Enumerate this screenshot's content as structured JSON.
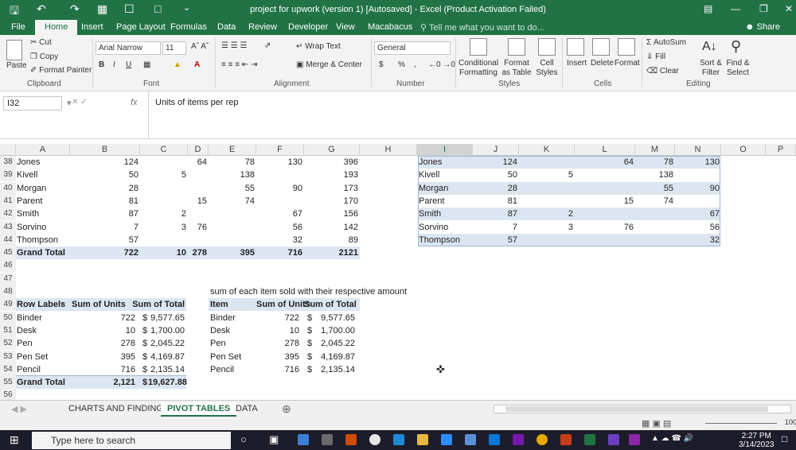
{
  "window": {
    "title": "project for upwork (version 1) [Autosaved] - Excel (Product Activation Failed)"
  },
  "tabs": [
    "File",
    "Home",
    "Insert",
    "Page Layout",
    "Formulas",
    "Data",
    "Review",
    "Developer",
    "View",
    "Macabacus"
  ],
  "active_tab": "Home",
  "tell_me": "Tell me what you want to do...",
  "share": "Share",
  "ribbon": {
    "clipboard": {
      "group": "Clipboard",
      "paste": "Paste",
      "cut": "Cut",
      "copy": "Copy",
      "format_painter": "Format Painter"
    },
    "font": {
      "group": "Font",
      "name": "Arial Narrow",
      "size": "11",
      "bold": "B",
      "italic": "I",
      "underline": "U"
    },
    "alignment": {
      "group": "Alignment",
      "wrap": "Wrap Text",
      "merge": "Merge & Center"
    },
    "number": {
      "group": "Number",
      "format": "General",
      "currency": "$",
      "percent": "%",
      "comma": ","
    },
    "styles": {
      "group": "Styles",
      "conditional": "Conditional Formatting",
      "format_table": "Format as Table",
      "cell_styles": "Cell Styles"
    },
    "cells": {
      "group": "Cells",
      "insert": "Insert",
      "delete": "Delete",
      "format": "Format"
    },
    "editing": {
      "group": "Editing",
      "autosum": "AutoSum",
      "fill": "Fill",
      "clear": "Clear",
      "sort": "Sort & Filter",
      "find": "Find & Select"
    }
  },
  "formula_bar": {
    "name_box": "I32",
    "fx": "fx",
    "formula": "Units of items per rep"
  },
  "columns": [
    "A",
    "B",
    "C",
    "D",
    "E",
    "F",
    "G",
    "H",
    "I",
    "J",
    "K",
    "L",
    "M",
    "N",
    "O",
    "P"
  ],
  "selected_column": "I",
  "rows": [
    "38",
    "39",
    "40",
    "41",
    "42",
    "43",
    "44",
    "45",
    "46",
    "47",
    "48",
    "49",
    "50",
    "51",
    "52",
    "53",
    "54",
    "55",
    "56"
  ],
  "left_table": [
    [
      "Jones",
      "124",
      "",
      "64",
      "78",
      "130",
      "396"
    ],
    [
      "Kivell",
      "50",
      "5",
      "",
      "138",
      "",
      "193"
    ],
    [
      "Morgan",
      "28",
      "",
      "",
      "55",
      "90",
      "173"
    ],
    [
      "Parent",
      "81",
      "",
      "15",
      "74",
      "",
      "170"
    ],
    [
      "Smith",
      "87",
      "2",
      "",
      "",
      "67",
      "156"
    ],
    [
      "Sorvino",
      "7",
      "3",
      "76",
      "",
      "56",
      "142"
    ],
    [
      "Thompson",
      "57",
      "",
      "",
      "",
      "32",
      "89"
    ],
    [
      "Grand Total",
      "722",
      "10",
      "278",
      "395",
      "716",
      "2121"
    ]
  ],
  "right_table": [
    [
      "Jones",
      "124",
      "",
      "64",
      "78",
      "130"
    ],
    [
      "Kivell",
      "50",
      "5",
      "",
      "138",
      ""
    ],
    [
      "Morgan",
      "28",
      "",
      "",
      "55",
      "90"
    ],
    [
      "Parent",
      "81",
      "",
      "15",
      "74",
      ""
    ],
    [
      "Smith",
      "87",
      "2",
      "",
      "",
      "67"
    ],
    [
      "Sorvino",
      "7",
      "3",
      "76",
      "",
      "56"
    ],
    [
      "Thompson",
      "57",
      "",
      "",
      "",
      "32"
    ]
  ],
  "pivot": {
    "headers": [
      "Row Labels",
      "Sum of Units",
      "Sum of Total"
    ],
    "rows": [
      [
        "Binder",
        "722",
        "$",
        "9,577.65"
      ],
      [
        "Desk",
        "10",
        "$",
        "1,700.00"
      ],
      [
        "Pen",
        "278",
        "$",
        "2,045.22"
      ],
      [
        "Pen Set",
        "395",
        "$",
        "4,169.87"
      ],
      [
        "Pencil",
        "716",
        "$",
        "2,135.14"
      ]
    ],
    "total": [
      "Grand Total",
      "2,121",
      "$",
      "19,627.88"
    ]
  },
  "summary": {
    "caption": "sum of each item sold with their respective amount",
    "headers": [
      "Item",
      "Sum of Units",
      "Sum of Total"
    ],
    "rows": [
      [
        "Binder",
        "722",
        "$",
        "9,577.65"
      ],
      [
        "Desk",
        "10",
        "$",
        "1,700.00"
      ],
      [
        "Pen",
        "278",
        "$",
        "2,045.22"
      ],
      [
        "Pen Set",
        "395",
        "$",
        "4,169.87"
      ],
      [
        "Pencil",
        "716",
        "$",
        "2,135.14"
      ]
    ]
  },
  "sheets": [
    "CHARTS AND FINDINGS",
    "PIVOT TABLES",
    "DATA"
  ],
  "active_sheet": "PIVOT TABLES",
  "zoom": "100",
  "taskbar": {
    "search": "Type here to search",
    "time": "2:27 PM",
    "date": "3/14/2023"
  },
  "colors": {
    "excel_green": "#217346",
    "band": "#dce6f1",
    "taskbar": "#1c1c2a"
  }
}
